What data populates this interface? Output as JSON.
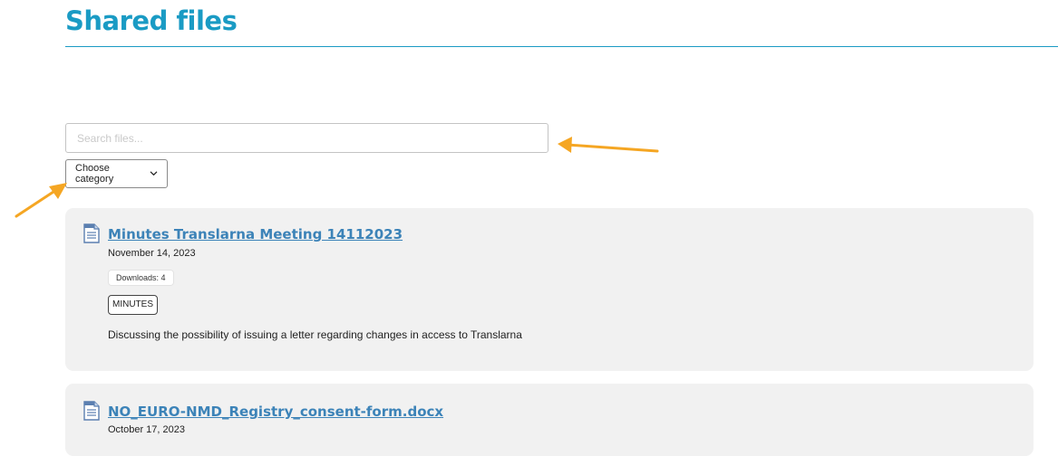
{
  "header": {
    "title": "Shared files"
  },
  "search": {
    "placeholder": "Search files...",
    "value": ""
  },
  "filter": {
    "category_label": "Choose category"
  },
  "files": [
    {
      "title": "Minutes Translarna Meeting 14112023",
      "date": "November 14, 2023",
      "downloads": "Downloads: 4",
      "tag": "MINUTES",
      "description": "Discussing the possibility of issuing a letter regarding changes in access to Translarna"
    },
    {
      "title": "NO_EURO-NMD_Registry_consent-form.docx",
      "date": "October 17, 2023"
    }
  ],
  "colors": {
    "title": "#1a9bc4",
    "link": "#3c83b8",
    "card_bg": "#f1f1f1",
    "annotation_arrow": "#f5a623"
  },
  "icons": {
    "file": "document-icon",
    "dropdown": "chevron-down-icon"
  }
}
